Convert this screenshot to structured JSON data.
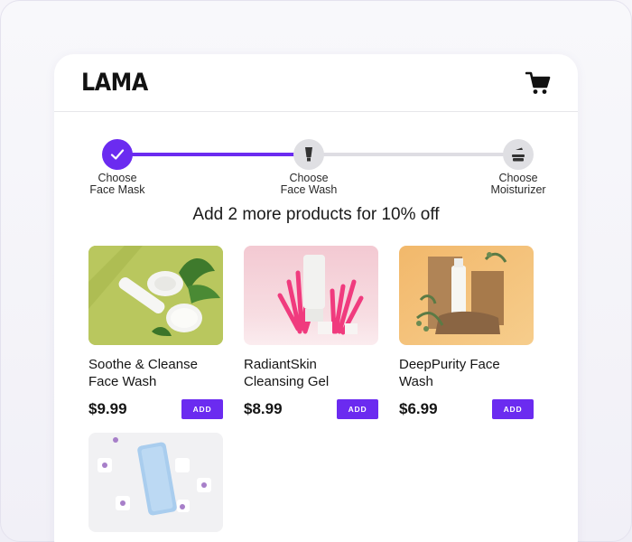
{
  "brand": "LAMA",
  "colors": {
    "accent": "#6b2bf0",
    "track": "#dedde3"
  },
  "stepper": {
    "steps": [
      {
        "line1": "Choose",
        "line2": "Face Mask",
        "state": "done",
        "icon": "check-icon"
      },
      {
        "line1": "Choose",
        "line2": "Face Wash",
        "state": "current",
        "icon": "tube-icon"
      },
      {
        "line1": "Choose",
        "line2": "Moisturizer",
        "state": "pending",
        "icon": "cream-jar-icon"
      }
    ]
  },
  "promo": "Add 2 more products for 10% off",
  "products": [
    {
      "name_line1": "Soothe & Cleanse",
      "name_line2": "Face Wash",
      "price": "$9.99",
      "add_label": "ADD"
    },
    {
      "name_line1": "RadiantSkin",
      "name_line2": "Cleansing Gel",
      "price": "$8.99",
      "add_label": "ADD"
    },
    {
      "name_line1": "DeepPurity Face",
      "name_line2": "Wash",
      "price": "$6.99",
      "add_label": "ADD"
    },
    {
      "name_line1": "",
      "name_line2": "",
      "price": "",
      "add_label": ""
    }
  ]
}
